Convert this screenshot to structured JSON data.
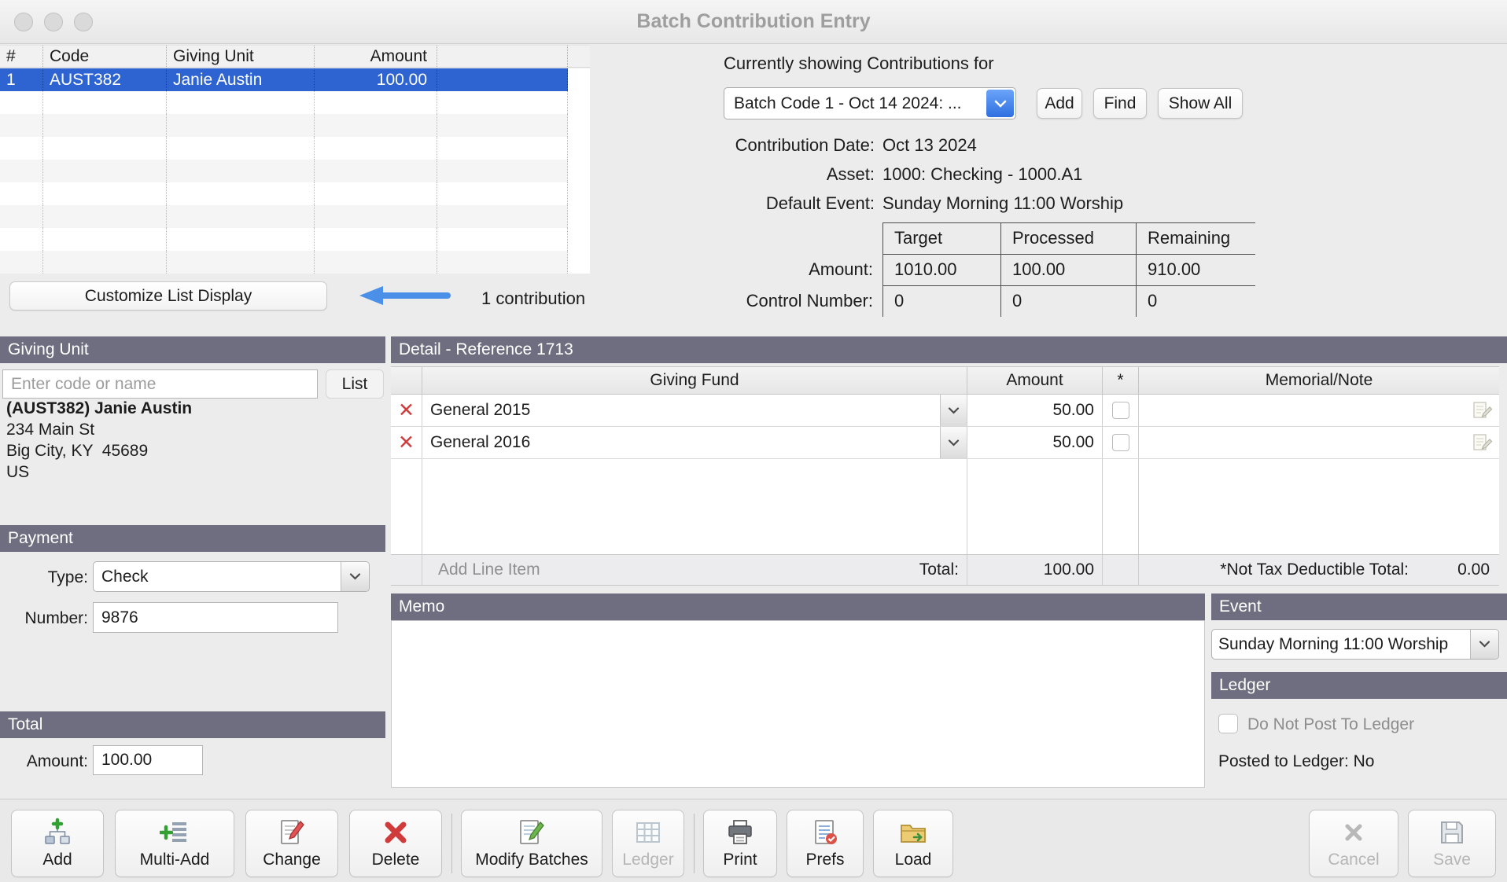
{
  "window": {
    "title": "Batch Contribution Entry"
  },
  "icons": {
    "delete_glyph": "✕"
  },
  "colors": {
    "accent_blue": "#3f7ef0",
    "header_bar": "#6e6e80",
    "selection_blue": "#2e64d2",
    "delete_red": "#d03c3c",
    "arrow_blue": "#4a90e8"
  },
  "contribution_list": {
    "columns": [
      "#",
      "Code",
      "Giving Unit",
      "Amount"
    ],
    "rows": [
      {
        "num": "1",
        "code": "AUST382",
        "giving_unit": "Janie Austin",
        "amount": "100.00"
      }
    ],
    "customize_button_label": "Customize List Display",
    "count_label": "1 contribution"
  },
  "batch_panel": {
    "heading": "Currently showing Contributions for",
    "batch_dropdown_value": "Batch Code 1 - Oct 14 2024: ...",
    "add_button": "Add",
    "find_button": "Find",
    "show_all_button": "Show All",
    "contribution_date_label": "Contribution Date:",
    "contribution_date_value": "Oct 13 2024",
    "asset_label": "Asset:",
    "asset_value": "1000: Checking - 1000.A1",
    "default_event_label": "Default Event:",
    "default_event_value": "Sunday Morning 11:00 Worship",
    "summary": {
      "col_target": "Target",
      "col_processed": "Processed",
      "col_remaining": "Remaining",
      "amount_label": "Amount:",
      "amount_target": "1010.00",
      "amount_processed": "100.00",
      "amount_remaining": "910.00",
      "control_label": "Control Number:",
      "control_target": "0",
      "control_processed": "0",
      "control_remaining": "0"
    }
  },
  "giving_unit": {
    "header": "Giving Unit",
    "search_placeholder": "Enter code or name",
    "list_button": "List",
    "name": "(AUST382) Janie Austin",
    "address_line1": "234 Main St",
    "address_line2": "Big City, KY  45689",
    "address_line3": "US"
  },
  "payment": {
    "header": "Payment",
    "type_label": "Type:",
    "type_value": "Check",
    "number_label": "Number:",
    "number_value": "9876"
  },
  "total_section": {
    "header": "Total",
    "amount_label": "Amount:",
    "amount_value": "100.00"
  },
  "detail": {
    "header": "Detail - Reference 1713",
    "col_fund": "Giving Fund",
    "col_amount": "Amount",
    "col_star": "*",
    "col_memo": "Memorial/Note",
    "line_items": [
      {
        "fund": "General 2015",
        "amount": "50.00"
      },
      {
        "fund": "General 2016",
        "amount": "50.00"
      }
    ],
    "add_line_item_label": "Add Line Item",
    "total_label": "Total:",
    "total_value": "100.00",
    "ntd_label": "*Not Tax Deductible Total:",
    "ntd_value": "0.00"
  },
  "memo_section": {
    "header": "Memo",
    "value": ""
  },
  "event_section": {
    "header": "Event",
    "value": "Sunday Morning 11:00 Worship"
  },
  "ledger_section": {
    "header": "Ledger",
    "checkbox_label": "Do Not Post To Ledger",
    "posted_text": "Posted to Ledger: No"
  },
  "toolbar": {
    "add": "Add",
    "multi_add": "Multi-Add",
    "change": "Change",
    "delete": "Delete",
    "modify_batches": "Modify Batches",
    "ledger": "Ledger",
    "print": "Print",
    "prefs": "Prefs",
    "load": "Load",
    "cancel": "Cancel",
    "save": "Save"
  }
}
